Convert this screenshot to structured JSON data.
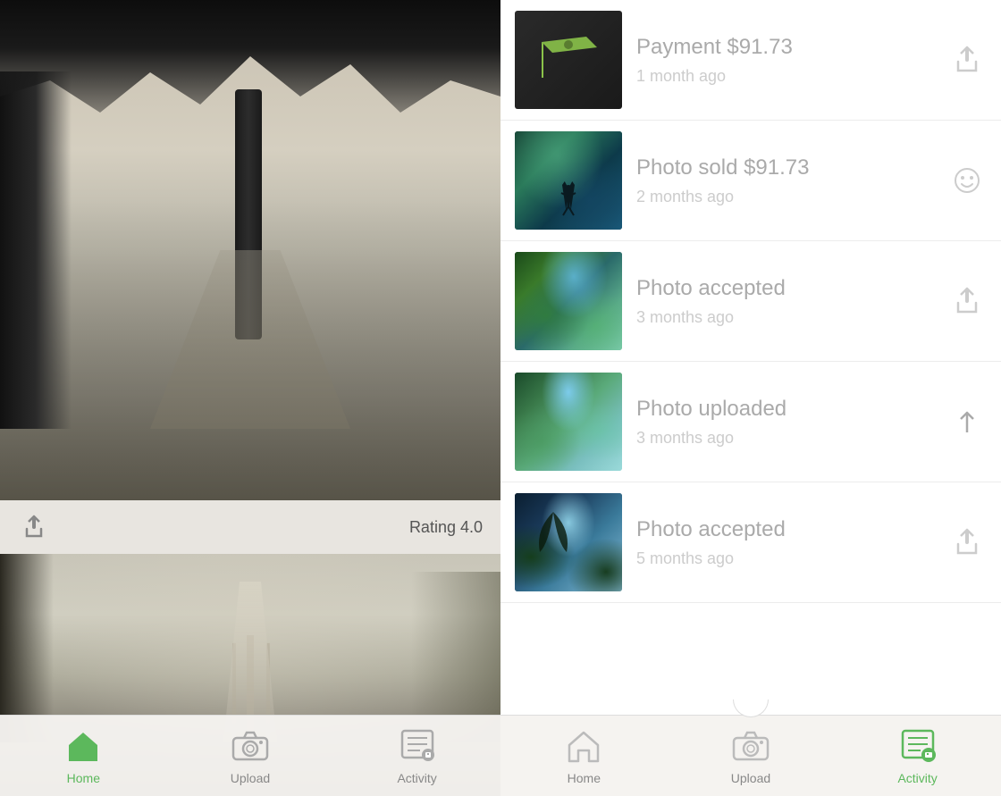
{
  "left": {
    "rating": "Rating 4.0",
    "nav": {
      "home": {
        "label": "Home",
        "active": true
      },
      "upload": {
        "label": "Upload",
        "active": false
      },
      "activity": {
        "label": "Activity",
        "active": false
      }
    }
  },
  "right": {
    "activity_items": [
      {
        "id": 1,
        "title": "Payment $91.73",
        "time": "1 month ago",
        "action": "share",
        "thumb_type": "payment"
      },
      {
        "id": 2,
        "title": "Photo sold $91.73",
        "time": "2 months ago",
        "action": "smile",
        "thumb_type": "sold"
      },
      {
        "id": 3,
        "title": "Photo accepted",
        "time": "3 months ago",
        "action": "share",
        "thumb_type": "accepted1"
      },
      {
        "id": 4,
        "title": "Photo uploaded",
        "time": "3 months ago",
        "action": "upload",
        "thumb_type": "uploaded"
      },
      {
        "id": 5,
        "title": "Photo accepted",
        "time": "5 months ago",
        "action": "share",
        "thumb_type": "accepted2"
      }
    ],
    "nav": {
      "home": {
        "label": "Home",
        "active": false
      },
      "upload": {
        "label": "Upload",
        "active": false
      },
      "activity": {
        "label": "Activity",
        "active": true
      }
    }
  }
}
